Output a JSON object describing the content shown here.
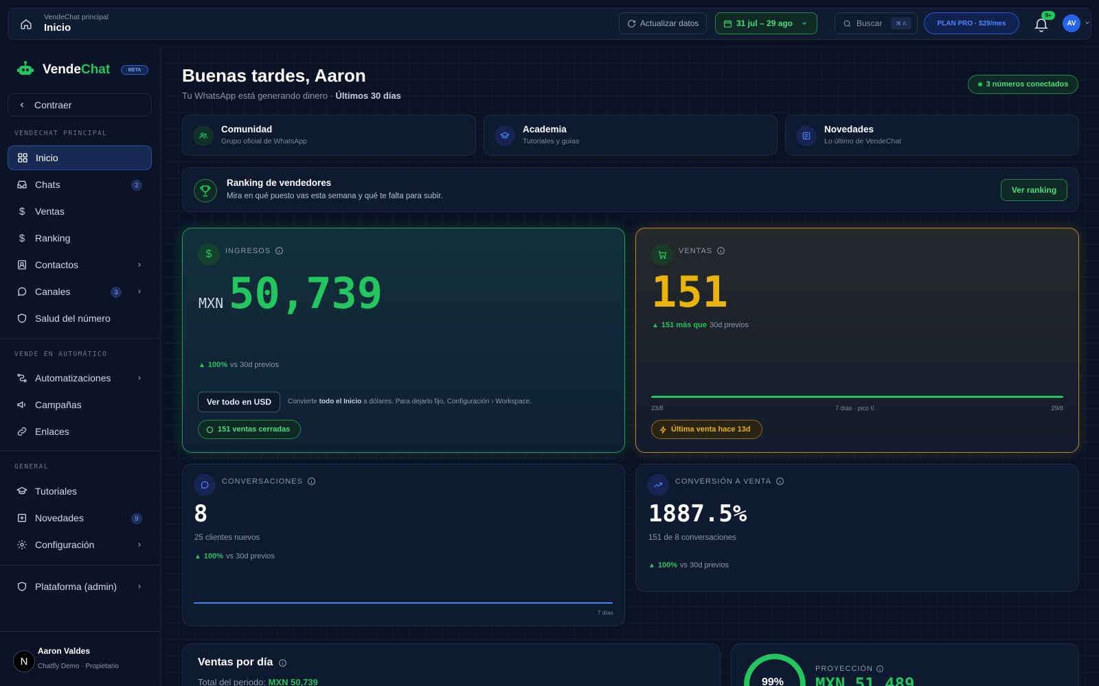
{
  "topbar": {
    "breadcrumb_section": "VendeChat principal",
    "breadcrumb_title": "Inicio",
    "refresh_label": "Actualizar datos",
    "date_range": "31 jul – 29 ago",
    "search_label": "Buscar",
    "search_shortcut": "⌘ K",
    "plan_label": "PLAN PRO · $29/mes",
    "notif_count": "9+",
    "avatar_initials": "AV"
  },
  "sidebar": {
    "brand_a": "Vende",
    "brand_b": "Chat",
    "beta": "BETA",
    "collapse_label": "Contraer",
    "sections": [
      "VENDECHAT PRINCIPAL",
      "VENDE EN AUTOMÁTICO",
      "GENERAL"
    ],
    "items": [
      {
        "label": "Inicio"
      },
      {
        "label": "Chats",
        "badge": "2"
      },
      {
        "label": "Ventas"
      },
      {
        "label": "Ranking"
      },
      {
        "label": "Contactos"
      },
      {
        "label": "Canales",
        "badge": "3"
      },
      {
        "label": "Salud del número"
      },
      {
        "label": "Automatizaciones"
      },
      {
        "label": "Campañas"
      },
      {
        "label": "Enlaces"
      },
      {
        "label": "Tutoriales"
      },
      {
        "label": "Novedades",
        "badge": "9"
      },
      {
        "label": "Configuración"
      },
      {
        "label": "Plataforma (admin)"
      }
    ],
    "user": {
      "initial": "N",
      "name": "Aaron Valdes",
      "subtitle": "Chatfly Demo · Propietario"
    }
  },
  "header": {
    "greeting": "Buenas tardes, Aaron",
    "subtitle_prefix": "Tu WhatsApp está generando dinero · ",
    "subtitle_bold": "Últimos 30 días",
    "connected": "3 números conectados"
  },
  "quick_links": [
    {
      "title": "Comunidad",
      "subtitle": "Grupo oficial de WhatsApp"
    },
    {
      "title": "Academia",
      "subtitle": "Tutoriales y guías"
    },
    {
      "title": "Novedades",
      "subtitle": "Lo último de VendeChat"
    }
  ],
  "ranking": {
    "title": "Ranking de vendedores",
    "subtitle": "Mira en qué puesto vas esta semana y qué te falta para subir.",
    "button": "Ver ranking"
  },
  "kpis": {
    "ingresos": {
      "label": "INGRESOS",
      "currency": "MXN",
      "value": "50,739",
      "delta": "100%",
      "delta_text": "vs 30d previos",
      "usd_button": "Ver todo en USD",
      "note_a": "Convierte ",
      "note_b": "todo el Inicio",
      "note_c": " a dólares. Para dejarlo fijo, Configuración › Workspace.",
      "pill": "151 ventas cerradas"
    },
    "ventas": {
      "label": "VENTAS",
      "value": "151",
      "delta": "151 más que",
      "delta_text": "30d previos",
      "axis_start": "23/8",
      "axis_mid": "7 días · pico 0",
      "axis_end": "29/8",
      "pill": "Última venta hace 13d"
    },
    "conversaciones": {
      "label": "CONVERSACIONES",
      "value": "8",
      "subtitle": "25 clientes nuevos",
      "delta": "100%",
      "delta_text": "vs 30d previos",
      "axis": "7 días"
    },
    "conversion": {
      "label": "CONVERSIÓN A VENTA",
      "value": "1887.5%",
      "subtitle": "151 de 8 conversaciones",
      "delta": "100%",
      "delta_text": "vs 30d previos"
    }
  },
  "ventas_por_dia": {
    "title": "Ventas por día",
    "subtitle_prefix": "Total del periodo: ",
    "subtitle_value": "MXN 50,739"
  },
  "proyeccion": {
    "ring": "99%",
    "label": "PROYECCIÓN",
    "value": "MXN 51,489"
  }
}
